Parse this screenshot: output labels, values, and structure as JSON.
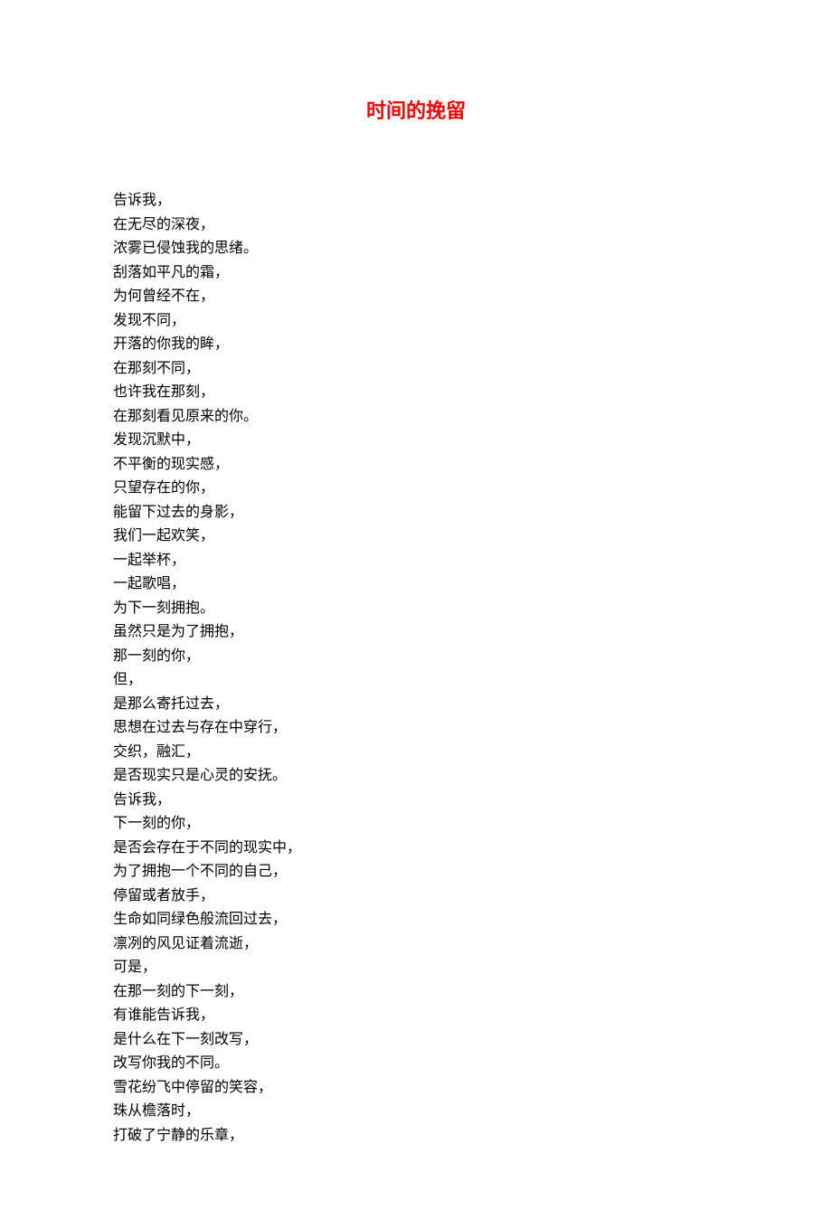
{
  "title": "时间的挽留",
  "lines": [
    "告诉我，",
    "在无尽的深夜，",
    "浓雾已侵蚀我的思绪。",
    "刮落如平凡的霜，",
    "为何曾经不在，",
    "发现不同，",
    "开落的你我的眸，",
    "在那刻不同，",
    "也许我在那刻，",
    "在那刻看见原来的你。",
    "发现沉默中，",
    "不平衡的现实感，",
    "只望存在的你，",
    "能留下过去的身影，",
    "我们一起欢笑，",
    "一起举杯，",
    "一起歌唱，",
    "为下一刻拥抱。",
    "虽然只是为了拥抱，",
    "那一刻的你，",
    "但，",
    "是那么寄托过去，",
    "思想在过去与存在中穿行，",
    "交织，融汇，",
    "是否现实只是心灵的安抚。",
    "告诉我，",
    "下一刻的你，",
    "是否会存在于不同的现实中，",
    "为了拥抱一个不同的自己，",
    "停留或者放手，",
    "生命如同绿色般流回过去，",
    "凛冽的风见证着流逝，",
    "可是，",
    "在那一刻的下一刻，",
    "有谁能告诉我，",
    "是什么在下一刻改写，",
    "改写你我的不同。",
    "雪花纷飞中停留的笑容，",
    "珠从檐落时，",
    "打破了宁静的乐章，"
  ]
}
